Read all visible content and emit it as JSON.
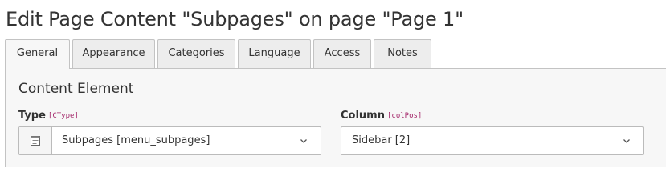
{
  "header": {
    "title": "Edit Page Content \"Subpages\" on page \"Page 1\""
  },
  "tabs": [
    {
      "label": "General",
      "active": true
    },
    {
      "label": "Appearance",
      "active": false
    },
    {
      "label": "Categories",
      "active": false
    },
    {
      "label": "Language",
      "active": false
    },
    {
      "label": "Access",
      "active": false
    },
    {
      "label": "Notes",
      "active": false
    }
  ],
  "section": {
    "title": "Content Element"
  },
  "fields": {
    "type": {
      "label": "Type",
      "code": "[CType]",
      "value": "Subpages [menu_subpages]",
      "icon": "content-element-icon"
    },
    "column": {
      "label": "Column",
      "code": "[colPos]",
      "value": "Sidebar [2]"
    }
  },
  "colors": {
    "code_accent": "#a4276a",
    "tab_inactive_bg": "#ededed",
    "panel_bg": "#f7f7f7"
  }
}
